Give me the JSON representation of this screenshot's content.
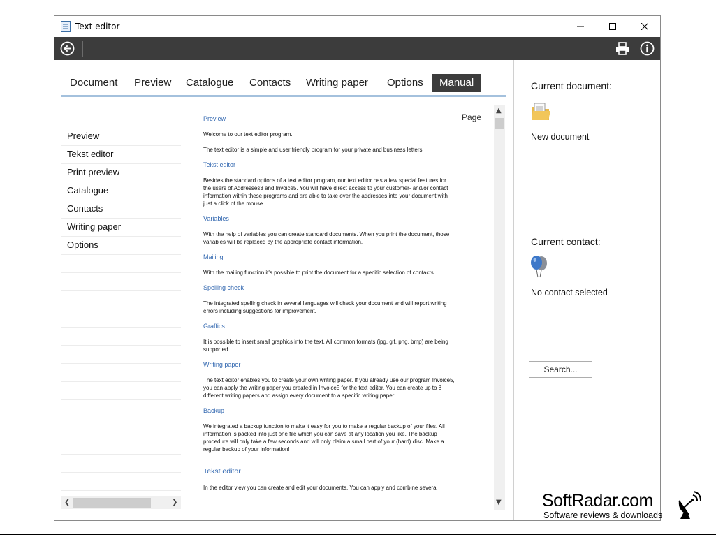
{
  "window": {
    "title": "Text editor"
  },
  "tabs": [
    {
      "label": "Document"
    },
    {
      "label": "Preview"
    },
    {
      "label": "Catalogue"
    },
    {
      "label": "Contacts"
    },
    {
      "label": "Writing paper"
    },
    {
      "label": "Options"
    },
    {
      "label": "Manual",
      "active": true
    }
  ],
  "nav": {
    "items": [
      "Preview",
      "Tekst editor",
      "Print preview",
      "Catalogue",
      "Contacts",
      "Writing paper",
      "Options"
    ]
  },
  "document": {
    "page_label": "Page",
    "heading_preview": "Preview",
    "p1": "Welcome to our text editor program.",
    "p2": "The text editor is a simple and user friendly program for your private and business letters.",
    "heading_tekst": "Tekst editor",
    "p3": "Besides the standard options of a text editor program, our text editor has a few special features for the users of Addresses3 and Invoice5. You will have direct access to your customer- and/or contact information within these programs and are able to take over the addresses into your document with just a click of the mouse.",
    "heading_variables": "Variables",
    "p4": "With the help of variables you can create standard documents. When you print the document, those variables will be replaced by the appropriate contact information.",
    "heading_mailing": "Mailing",
    "p5": "With the mailing function it's possible to print the document for a specific selection of contacts.",
    "heading_spelling": "Spelling check",
    "p6": "The integrated spelling check in several languages will check your document and will report writing errors including suggestions for improvement.",
    "heading_graphics": "Graffics",
    "p7": "It is possible to insert small graphics into the text. All common formats (jpg, gif, png, bmp) are being supported.",
    "heading_writing": "Writing paper",
    "p8": "The text editor enables you to create your own writing paper. If you already use our program Invoice5, you can apply the writing paper you created in Invoice5 for the text editor. You can create up to 8 different writing papers and assign every document to a specific writing paper.",
    "heading_backup": "Backup",
    "p9": "We integrated a backup function to make it easy for you to make a regular backup of your files. All information is packed into just one file which you can save at any location you like. The backup procedure will only take a few seconds and will only claim a small part of your (hard) disc. Make a regular backup of your information!",
    "heading_tekst2": "Tekst editor",
    "p10": "In the editor view you can create and edit your documents. You can apply and combine several"
  },
  "right_panel": {
    "current_document_label": "Current document:",
    "document_name": "New document",
    "current_contact_label": "Current contact:",
    "contact_status": "No contact selected",
    "search_button": "Search..."
  },
  "watermark": {
    "name": "SoftRadar.com",
    "tagline": "Software reviews & downloads"
  },
  "colors": {
    "toolbar_bg": "#3c3c3c",
    "tab_active_bg": "#3c3c3c",
    "tab_underline": "#a4c1dd",
    "heading_blue": "#3368b0"
  },
  "icons": {
    "app": "text-editor-app-icon",
    "back": "back-arrow-icon",
    "print": "printer-icon",
    "info": "info-icon",
    "document": "document-folder-icon",
    "contact": "contact-balloons-icon"
  }
}
